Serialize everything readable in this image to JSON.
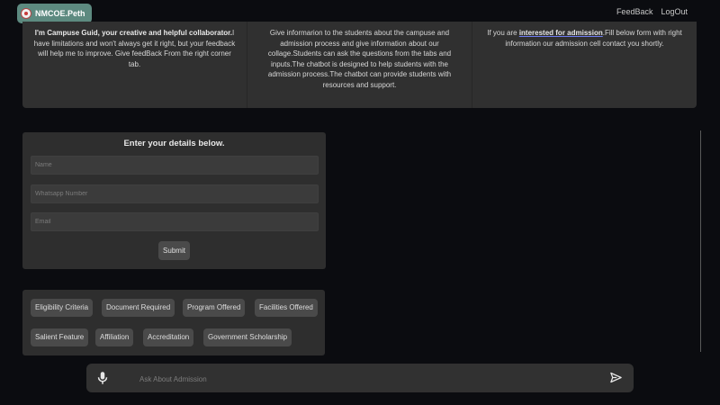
{
  "header": {
    "brand": "NMCOE.Peth",
    "nav": [
      "FeedBack",
      "LogOut"
    ]
  },
  "info": {
    "col1_bold": "I'm Campuse Guid, your creative and helpful collaborator.",
    "col1_text": "I have limitations and won't always get it right, but your feedback will help me to improve. Give feedBack From the right corner tab.",
    "col2_text": "Give informarion to the students about the campuse and admission process and give information about our collage.Students can ask the questions from the tabs and inputs.The chatbot is designed to help students with the admission process.The chatbot can provide students with resources and support.",
    "col3_pre": "If you are",
    "col3_link": "interested for admission",
    "col3_post": ".Fill below form with right information our admission cell contact you shortly."
  },
  "form": {
    "title": "Enter your details below.",
    "name_placeholder": "Name",
    "whatsapp_placeholder": "Whatsapp Number",
    "email_placeholder": "Email",
    "submit_label": "Submit"
  },
  "chips": [
    "Eligibility Criteria",
    "Document Required",
    "Program Offered",
    "Facilities Offered",
    "Salient Feature",
    "Affiliation",
    "Accreditation",
    "Government Scholarship"
  ],
  "chat": {
    "placeholder": "Ask About Admission"
  },
  "colors": {
    "background": "#0b0c10",
    "panel": "#303030",
    "brand": "#5d8a80",
    "chip": "#4a4a4a"
  },
  "icons": {
    "brand_logo": "college-seal-icon",
    "mic": "microphone-icon",
    "send": "send-icon"
  }
}
